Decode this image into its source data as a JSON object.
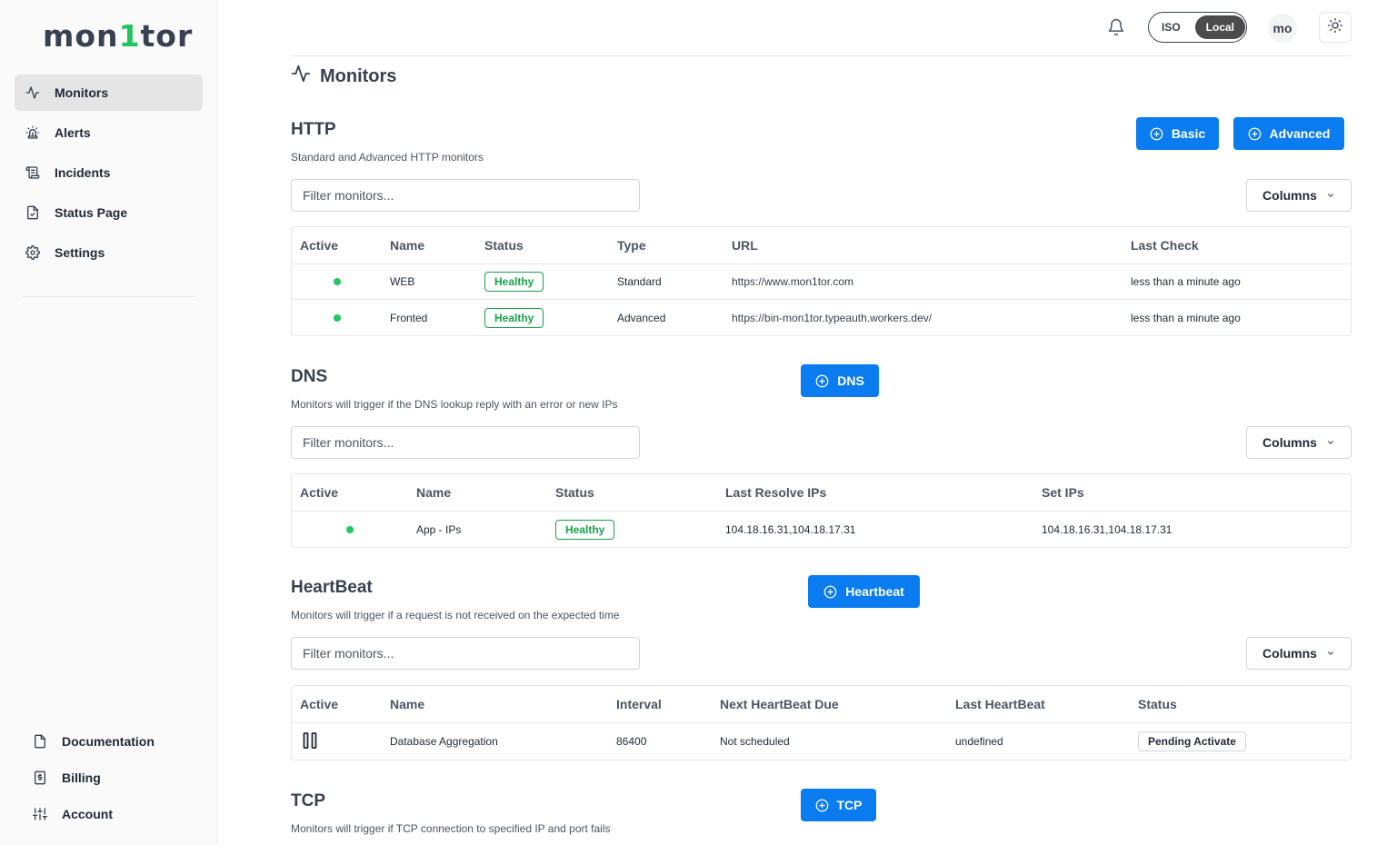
{
  "app": {
    "logo_part1": "mon",
    "logo_one": "1",
    "logo_part2": "tor"
  },
  "sidebar": {
    "items": [
      {
        "label": "Monitors",
        "icon": "activity-icon",
        "active": true
      },
      {
        "label": "Alerts",
        "icon": "siren-icon"
      },
      {
        "label": "Incidents",
        "icon": "scroll-icon"
      },
      {
        "label": "Status Page",
        "icon": "file-check-icon"
      },
      {
        "label": "Settings",
        "icon": "gear-icon"
      }
    ],
    "bottom": [
      {
        "label": "Documentation",
        "icon": "file-icon"
      },
      {
        "label": "Billing",
        "icon": "receipt-icon"
      },
      {
        "label": "Account",
        "icon": "sliders-icon"
      }
    ]
  },
  "topbar": {
    "tz_options": [
      "ISO",
      "Local"
    ],
    "tz_selected": "Local",
    "avatar": "mo"
  },
  "page": {
    "title": "Monitors"
  },
  "http": {
    "title": "HTTP",
    "description": "Standard and Advanced HTTP monitors",
    "btn_basic": "Basic",
    "btn_advanced": "Advanced",
    "filter_placeholder": "Filter monitors...",
    "columns_label": "Columns",
    "headers": [
      "Active",
      "Name",
      "Status",
      "Type",
      "URL",
      "Last Check"
    ],
    "rows": [
      {
        "active": true,
        "name": "WEB",
        "status": "Healthy",
        "type": "Standard",
        "url": "https://www.mon1tor.com",
        "last_check": "less than a minute ago"
      },
      {
        "active": true,
        "name": "Fronted",
        "status": "Healthy",
        "type": "Advanced",
        "url": "https://bin-mon1tor.typeauth.workers.dev/",
        "last_check": "less than a minute ago"
      }
    ]
  },
  "dns": {
    "title": "DNS",
    "description": "Monitors will trigger if the DNS lookup reply with an error or new IPs",
    "btn": "DNS",
    "filter_placeholder": "Filter monitors...",
    "columns_label": "Columns",
    "headers": [
      "Active",
      "Name",
      "Status",
      "Last Resolve IPs",
      "Set IPs"
    ],
    "rows": [
      {
        "active": true,
        "name": "App - IPs",
        "status": "Healthy",
        "last_resolve": "104.18.16.31,104.18.17.31",
        "set_ips": "104.18.16.31,104.18.17.31"
      }
    ]
  },
  "heartbeat": {
    "title": "HeartBeat",
    "description": "Monitors will trigger if a request is not received on the expected time",
    "btn": "Heartbeat",
    "filter_placeholder": "Filter monitors...",
    "columns_label": "Columns",
    "headers": [
      "Active",
      "Name",
      "Interval",
      "Next HeartBeat Due",
      "Last HeartBeat",
      "Status"
    ],
    "rows": [
      {
        "active_icon": "pause-icon",
        "name": "Database Aggregation",
        "interval": "86400",
        "next_due": "Not scheduled",
        "last": "undefined",
        "status": "Pending Activate"
      }
    ]
  },
  "tcp": {
    "title": "TCP",
    "description": "Monitors will trigger if TCP connection to specified IP and port fails",
    "btn": "TCP"
  },
  "colors": {
    "primary": "#0a7cf0",
    "healthy": "#16a34a",
    "dot": "#22c55e"
  }
}
